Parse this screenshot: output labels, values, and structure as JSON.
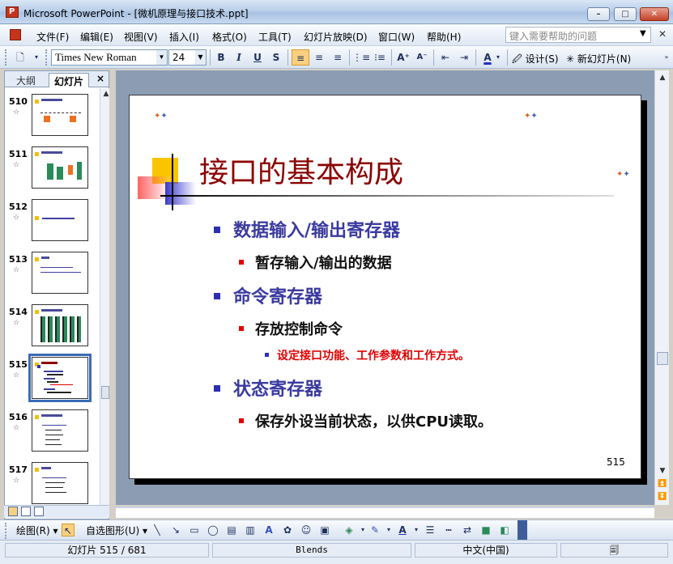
{
  "window": {
    "title": "Microsoft PowerPoint - [微机原理与接口技术.ppt]",
    "app_icon_text": "P",
    "buttons": [
      "minimize",
      "maximize",
      "close"
    ]
  },
  "menu": {
    "items": [
      "文件(F)",
      "编辑(E)",
      "视图(V)",
      "插入(I)",
      "格式(O)",
      "工具(T)",
      "幻灯片放映(D)",
      "窗口(W)",
      "帮助(H)"
    ],
    "help_placeholder": "键入需要帮助的问题"
  },
  "format_toolbar": {
    "font": "Times New Roman",
    "size": "24",
    "bold": "B",
    "italic": "I",
    "underline": "U",
    "shadow": "S",
    "design_label": "设计(S)",
    "new_slide_label": "新幻灯片(N)"
  },
  "left_panel": {
    "tab_outline": "大纲",
    "tab_slides": "幻灯片",
    "close": "×",
    "thumbnails": [
      {
        "num": "510",
        "selected": false
      },
      {
        "num": "511",
        "selected": false
      },
      {
        "num": "512",
        "selected": false
      },
      {
        "num": "513",
        "selected": false
      },
      {
        "num": "514",
        "selected": false
      },
      {
        "num": "515",
        "selected": true
      },
      {
        "num": "516",
        "selected": false
      },
      {
        "num": "517",
        "selected": false
      }
    ]
  },
  "slide": {
    "title": "接口的基本构成",
    "bullets": [
      {
        "level": 1,
        "text": "数据输入/输出寄存器"
      },
      {
        "level": 2,
        "text": "暂存输入/输出的数据"
      },
      {
        "level": 1,
        "text": "命令寄存器"
      },
      {
        "level": 2,
        "text": "存放控制命令"
      },
      {
        "level": 3,
        "text": "设定接口功能、工作参数和工作方式。"
      },
      {
        "level": 1,
        "text": "状态寄存器"
      },
      {
        "level": 2,
        "text": "保存外设当前状态，以供CPU读取。"
      }
    ],
    "number": "515",
    "colors": {
      "title": "#8b0000",
      "level1": "#3a3aa0",
      "level2": "#111111",
      "level3": "#e00000"
    }
  },
  "draw_toolbar": {
    "draw_label": "绘图(R)",
    "autoshapes_label": "自选图形(U)"
  },
  "status": {
    "slide_info": "幻灯片 515 / 681",
    "design": "Blends",
    "language": "中文(中国)"
  }
}
